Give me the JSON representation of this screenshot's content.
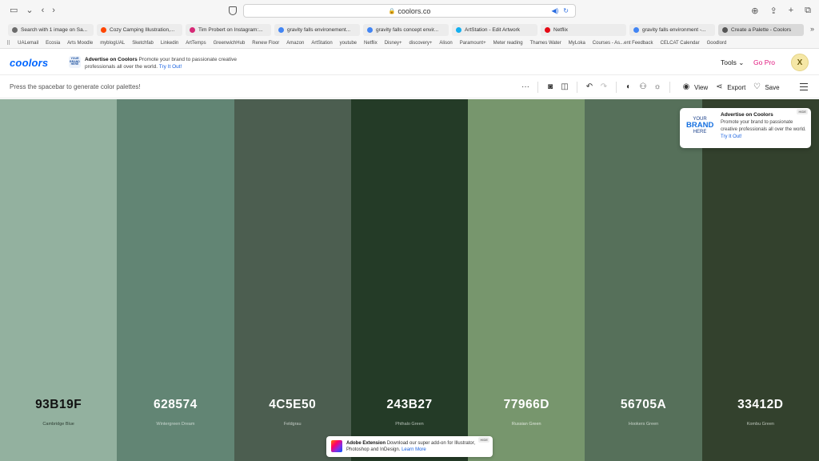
{
  "browser": {
    "address": "coolors.co",
    "tabs": [
      {
        "label": "Search with 1 image on Sa...",
        "color": "#6b6b6b",
        "active": false
      },
      {
        "label": "Cozy Camping Illustration,...",
        "color": "#ff4500",
        "active": false
      },
      {
        "label": "Tim Probert on Instagram:...",
        "color": "#d62976",
        "active": false
      },
      {
        "label": "gravity falls environement...",
        "color": "#4285f4",
        "active": false
      },
      {
        "label": "gravity falls concept envir...",
        "color": "#4285f4",
        "active": false
      },
      {
        "label": "ArtStation - Edit Artwork",
        "color": "#13aff0",
        "active": false
      },
      {
        "label": "Netflix",
        "color": "#e50914",
        "active": false
      },
      {
        "label": "gravity falls environment -...",
        "color": "#4285f4",
        "active": false
      },
      {
        "label": "Create a Palette - Coolors",
        "color": "#555555",
        "active": true
      }
    ],
    "bookmarks": [
      "UALemail",
      "Ecosia",
      "Arts Moodle",
      "myblogUAL",
      "Sketchfab",
      "Linkedin",
      "ArtTemps",
      "GreenwichHub",
      "Renew Floor",
      "Amazon",
      "ArtStation",
      "youtube",
      "Netflix",
      "Disney+",
      "discovery+",
      "Alison",
      "Paramount+",
      "Meter reading",
      "Thames Water",
      "MyLoka",
      "Courses - As...ent Feedback",
      "CELCAT Calendar",
      "Goodlord"
    ]
  },
  "header": {
    "logo": "coolors",
    "ad_badge": "YOUR BRAND HERE",
    "ad_title": "Advertise on Coolors",
    "ad_text": "Promote your brand to passionate creative professionals all over the world.",
    "ad_link": "Try It Out!",
    "tools": "Tools",
    "gopro": "Go Pro",
    "avatar_initial": "X"
  },
  "toolbar": {
    "hint": "Press the spacebar to generate color palettes!",
    "view": "View",
    "export": "Export",
    "save": "Save"
  },
  "palette": [
    {
      "hex": "93B19F",
      "name": "Cambridge Blue",
      "color": "#93B19F",
      "text": "#111111",
      "sub": "#2f3f35"
    },
    {
      "hex": "628574",
      "name": "Wintergreen Dream",
      "color": "#628574",
      "text": "#ffffff",
      "sub": "#c9d6cf"
    },
    {
      "hex": "4C5E50",
      "name": "Feldgrau",
      "color": "#4C5E50",
      "text": "#ffffff",
      "sub": "#c4ccc6"
    },
    {
      "hex": "243B27",
      "name": "Phthalo Green",
      "color": "#243B27",
      "text": "#ffffff",
      "sub": "#b7c2b9"
    },
    {
      "hex": "77966D",
      "name": "Russian Green",
      "color": "#77966D",
      "text": "#ffffff",
      "sub": "#dfe7dc"
    },
    {
      "hex": "56705A",
      "name": "Hookers Green",
      "color": "#56705A",
      "text": "#ffffff",
      "sub": "#cad4cb"
    },
    {
      "hex": "33412D",
      "name": "Kombu Green",
      "color": "#33412D",
      "text": "#ffffff",
      "sub": "#bcc4b9"
    }
  ],
  "float_ad": {
    "brand_top": "YOUR",
    "brand_mid": "BRAND",
    "brand_bot": "HERE",
    "title": "Advertise on Coolors",
    "text": "Promote your brand to passionate creative professionals all over the world.",
    "link": "Try It Out!",
    "hide": "HIDE"
  },
  "bottom_ad": {
    "title": "Adobe Extension",
    "text": "Download our super add-on for Illustrator, Photoshop and InDesign.",
    "link": "Learn More",
    "hide": "HIDE"
  }
}
